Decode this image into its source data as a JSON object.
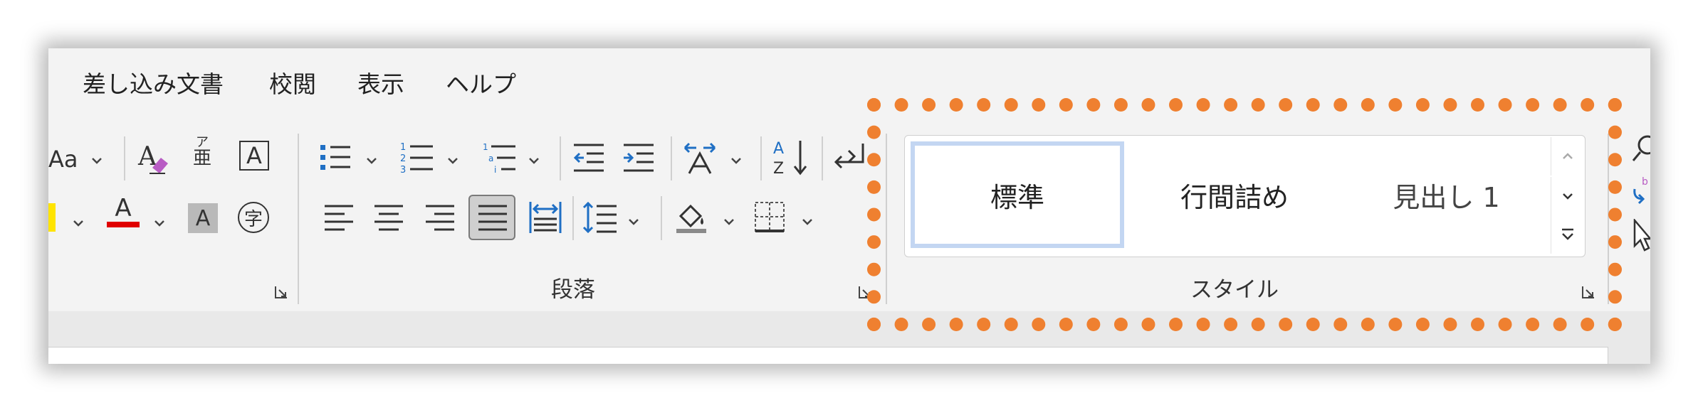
{
  "menu": {
    "tabs": [
      "差し込み文書",
      "校閲",
      "表示",
      "ヘルプ"
    ]
  },
  "font_group": {
    "change_case_label": "Aa",
    "phonetic_label_top": "ア",
    "phonetic_label_bottom": "亜",
    "border_char_label": "A",
    "font_color_label": "A",
    "char_shading_label": "A",
    "enclose_char_label": "字"
  },
  "paragraph_group": {
    "label": "段落"
  },
  "styles_group": {
    "label": "スタイル",
    "items": [
      "標準",
      "行間詰め",
      "見出し 1"
    ]
  },
  "colors": {
    "highlight": "#ef8030",
    "font_color": "#e00000",
    "highlighter": "#ffe400",
    "selected_style": "#c3d6f2",
    "accent_blue": "#1f6fc4"
  }
}
